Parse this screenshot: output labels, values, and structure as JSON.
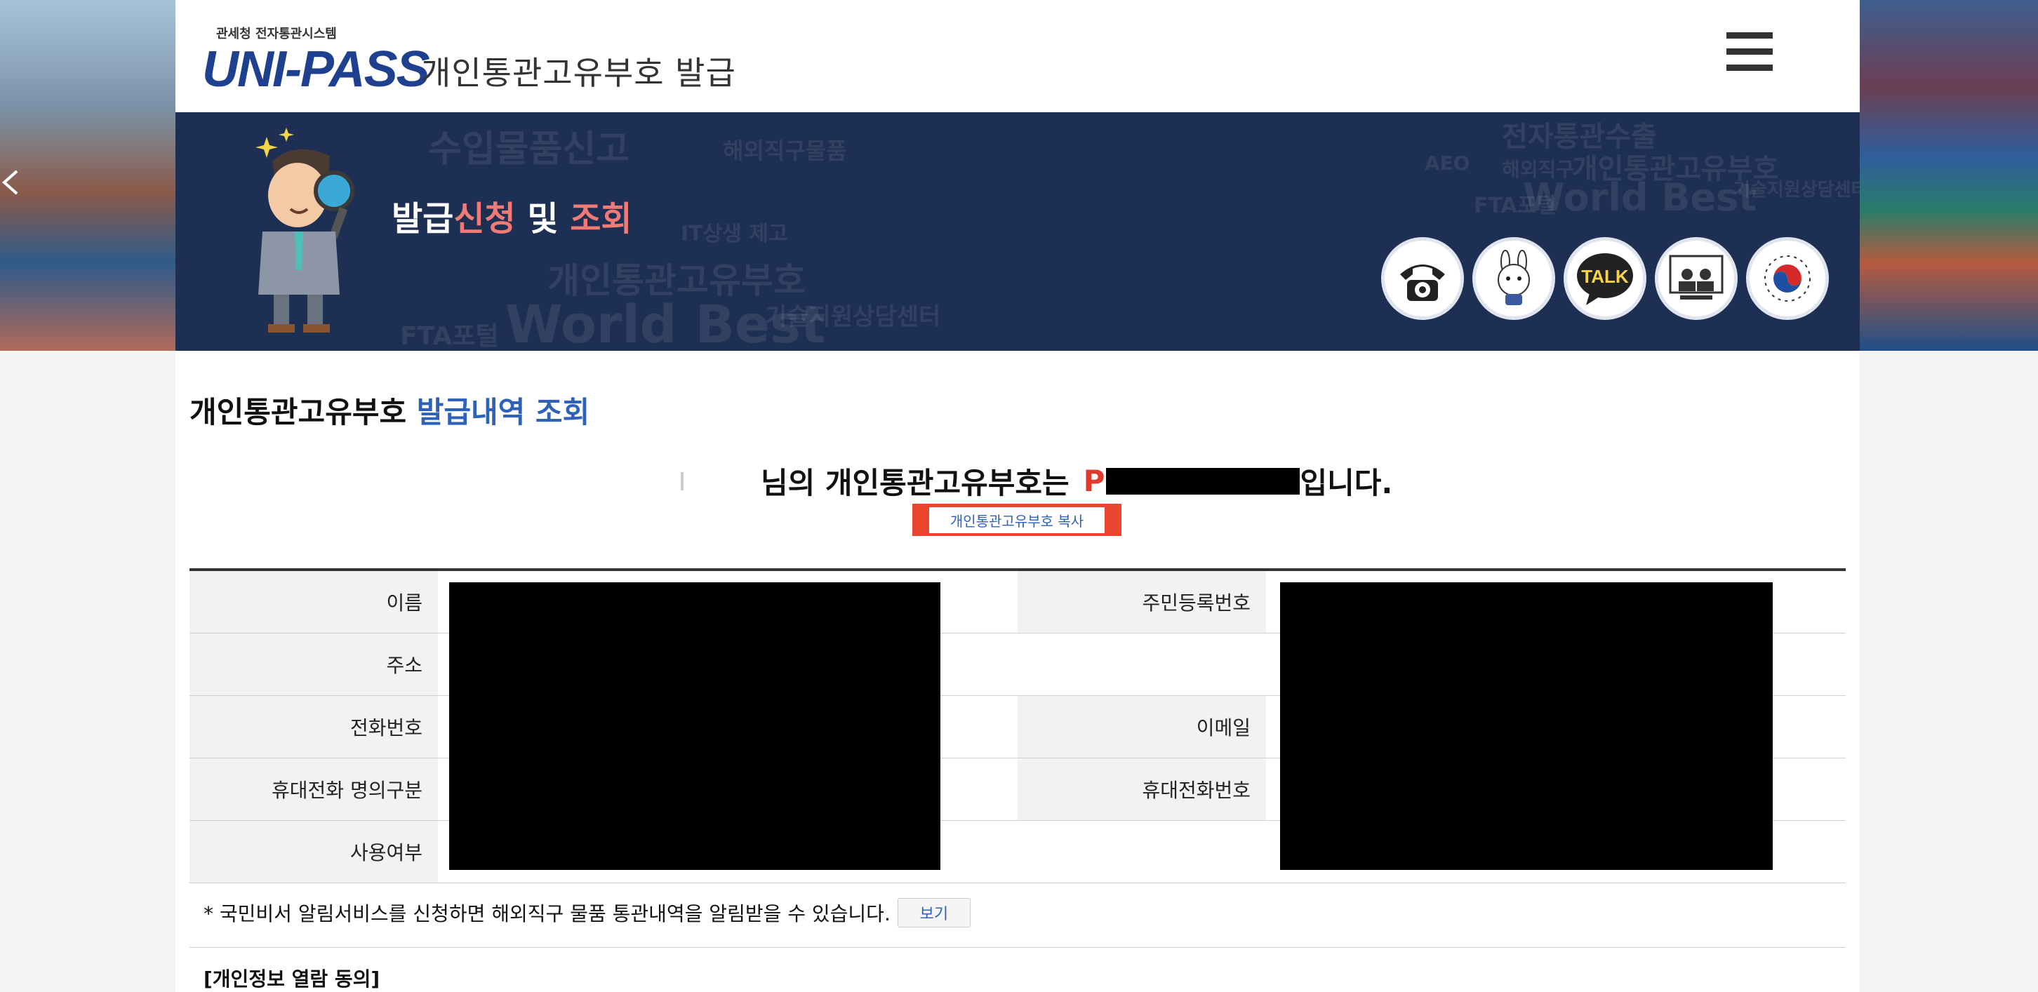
{
  "header": {
    "logo_small": "관세청 전자통관시스템",
    "logo_main": "UNI-PASS",
    "title": "개인통관고유부호 발급"
  },
  "banner": {
    "title_part1": "발급",
    "title_part2": "신청",
    "title_part3": " 및 ",
    "title_part4": "조회",
    "quick_icons": [
      "phone-icon",
      "mascot-rabbit-icon",
      "talk-icon",
      "video-consult-icon",
      "korea-emblem-icon"
    ],
    "talk_label": "TALK",
    "wordcloud": [
      "수입물품신고",
      "해외직구물품",
      "전자통관수출",
      "개인통관고유부호",
      "World Best",
      "FTA포털",
      "기술지원상담센터",
      "AEO",
      "해외직구",
      "IT상생 제고"
    ]
  },
  "main": {
    "title_part1": "개인통관고유부호",
    "title_part2": "발급내역 조회",
    "result_suffix": "님의 개인통관고유부호는",
    "code_prefix": "P",
    "result_end": "입니다.",
    "copy_button": "개인통관고유부호 복사"
  },
  "table": {
    "labels_left": [
      "이름",
      "주소",
      "전화번호",
      "휴대전화 명의구분",
      "사용여부"
    ],
    "labels_right": [
      "주민등록번호",
      "이메일",
      "휴대전화번호"
    ]
  },
  "notice": {
    "text": "* 국민비서 알림서비스를 신청하면 해외직구 물품 통관내역을 알림받을 수 있습니다.",
    "view_button": "보기"
  },
  "consent": {
    "heading": "[개인정보 열람 동의]"
  },
  "colors": {
    "banner_bg": "#1d2f52",
    "accent_blue": "#2d62b8",
    "accent_red": "#e03a2f",
    "highlight_pink": "#f07b76"
  }
}
